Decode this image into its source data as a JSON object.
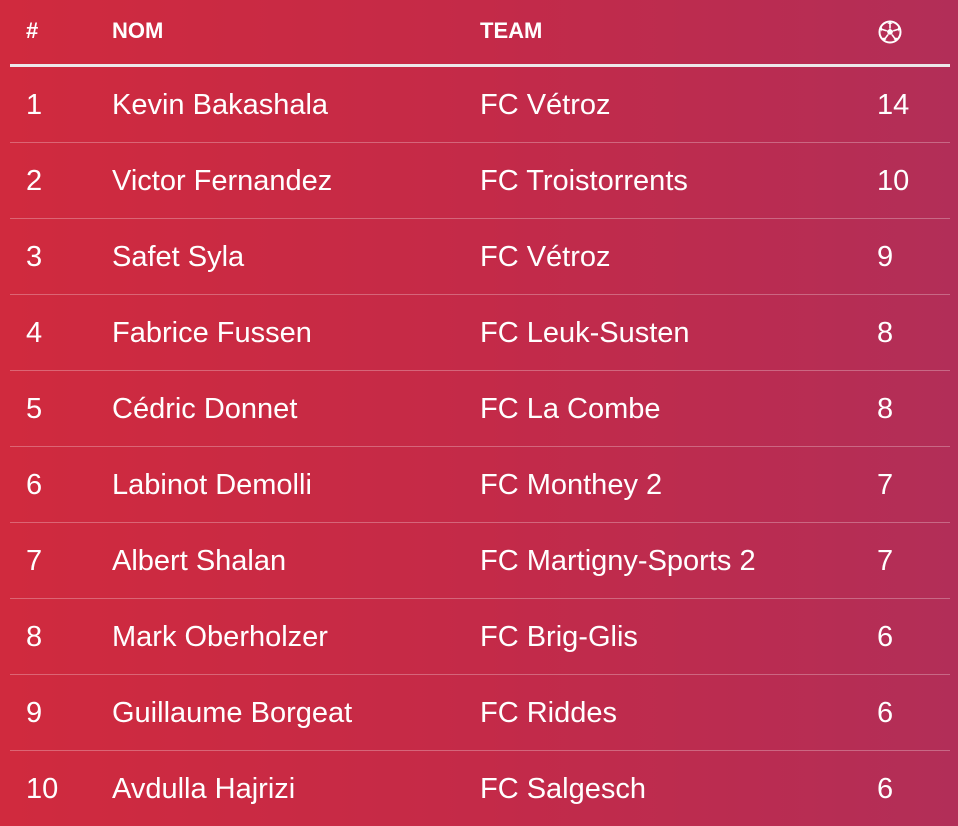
{
  "header": {
    "rank": "#",
    "name": "NOM",
    "team": "TEAM",
    "goals_icon": "soccer-ball-icon"
  },
  "rows": [
    {
      "rank": "1",
      "name": "Kevin Bakashala",
      "team": "FC Vétroz",
      "goals": "14"
    },
    {
      "rank": "2",
      "name": "Victor Fernandez",
      "team": "FC Troistorrents",
      "goals": "10"
    },
    {
      "rank": "3",
      "name": "Safet Syla",
      "team": "FC Vétroz",
      "goals": "9"
    },
    {
      "rank": "4",
      "name": "Fabrice Fussen",
      "team": "FC Leuk-Susten",
      "goals": "8"
    },
    {
      "rank": "5",
      "name": "Cédric Donnet",
      "team": "FC La Combe",
      "goals": "8"
    },
    {
      "rank": "6",
      "name": "Labinot Demolli",
      "team": "FC Monthey 2",
      "goals": "7"
    },
    {
      "rank": "7",
      "name": "Albert Shalan",
      "team": "FC Martigny-Sports 2",
      "goals": "7"
    },
    {
      "rank": "8",
      "name": "Mark Oberholzer",
      "team": "FC Brig-Glis",
      "goals": "6"
    },
    {
      "rank": "9",
      "name": "Guillaume Borgeat",
      "team": "FC Riddes",
      "goals": "6"
    },
    {
      "rank": "10",
      "name": "Avdulla Hajrizi",
      "team": "FC Salgesch",
      "goals": "6"
    }
  ],
  "colors": {
    "background_start": "#d02a3e",
    "background_end": "#b22e58",
    "text": "#ffffff"
  }
}
